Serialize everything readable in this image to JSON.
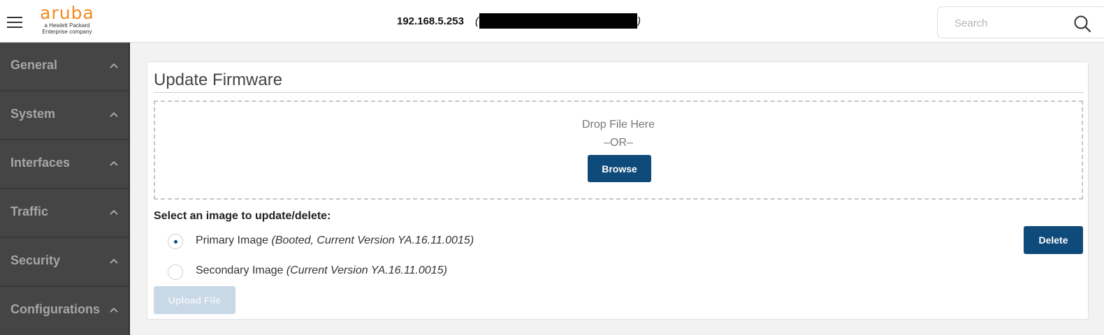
{
  "header": {
    "logo_word": "aruba",
    "logo_tagline_1": "a Hewlett Packard",
    "logo_tagline_2": "Enterprise company",
    "host": "192.168.5.253",
    "host_extra_open": "(",
    "host_extra_close": ")",
    "search_placeholder": "Search"
  },
  "sidebar": {
    "items": [
      {
        "label": "General"
      },
      {
        "label": "System"
      },
      {
        "label": "Interfaces"
      },
      {
        "label": "Traffic"
      },
      {
        "label": "Security"
      },
      {
        "label": "Configurations"
      }
    ]
  },
  "main": {
    "title": "Update Firmware",
    "drop_text": "Drop File Here",
    "or_text": "–OR–",
    "browse_label": "Browse",
    "select_heading": "Select an image to update/delete:",
    "images": [
      {
        "name": "Primary Image",
        "detail": "(Booted, Current Version YA.16.11.0015)",
        "selected": true
      },
      {
        "name": "Secondary Image",
        "detail": "(Current Version YA.16.11.0015)",
        "selected": false
      }
    ],
    "delete_label": "Delete",
    "upload_label": "Upload File"
  },
  "colors": {
    "brand_orange": "#f58a20",
    "button_blue": "#0e4a7a",
    "sidebar_bg": "#454545"
  },
  "icons": [
    "menu-icon",
    "search-icon",
    "chevron-up-icon"
  ]
}
